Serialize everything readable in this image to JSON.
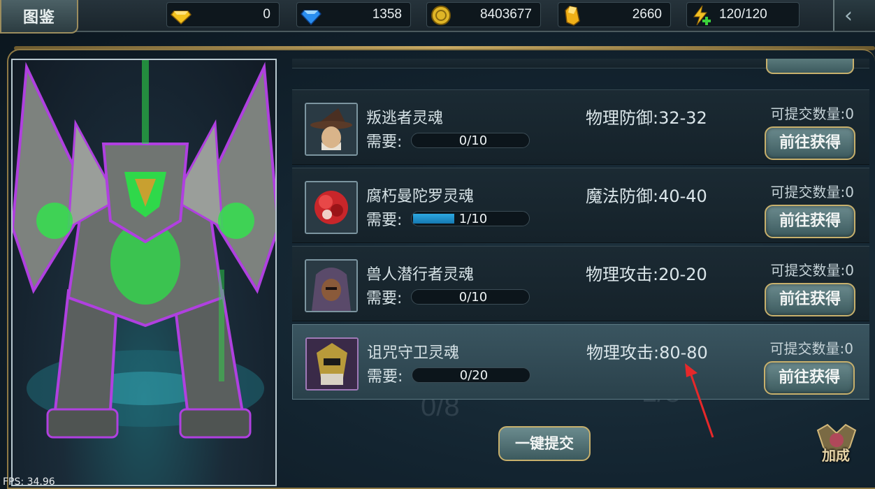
{
  "header": {
    "title": "图鉴",
    "resources": [
      {
        "icon": "yellow-gem-icon",
        "value": "0"
      },
      {
        "icon": "blue-diamond-icon",
        "value": "1358"
      },
      {
        "icon": "gold-coin-icon",
        "value": "8403677"
      },
      {
        "icon": "gold-crystal-icon",
        "value": "2660"
      },
      {
        "icon": "energy-plus-icon",
        "value": "120/120"
      }
    ]
  },
  "portrait": {
    "fps_label": "FPS:",
    "fps": "34.96"
  },
  "background_ghost": {
    "progress_a": "0/8",
    "progress_b": "1/8"
  },
  "items": [
    {
      "name": "叛逃者灵魂",
      "need_label": "需要:",
      "progress_text": "0/10",
      "progress": 0.0,
      "stat": "物理防御:32-32",
      "submit": "可提交数量:0",
      "button": "前往获得",
      "avatar": "wizard-hat-avatar"
    },
    {
      "name": "腐朽曼陀罗灵魂",
      "need_label": "需要:",
      "progress_text": "1/10",
      "progress": 0.1,
      "stat": "魔法防御:40-40",
      "submit": "可提交数量:0",
      "button": "前往获得",
      "avatar": "red-flower-avatar"
    },
    {
      "name": "兽人潜行者灵魂",
      "need_label": "需要:",
      "progress_text": "0/10",
      "progress": 0.0,
      "stat": "物理攻击:20-20",
      "submit": "可提交数量:0",
      "button": "前往获得",
      "avatar": "hooded-orc-avatar"
    },
    {
      "name": "诅咒守卫灵魂",
      "need_label": "需要:",
      "progress_text": "0/20",
      "progress": 0.0,
      "stat": "物理攻击:80-80",
      "submit": "可提交数量:0",
      "button": "前往获得",
      "avatar": "golden-guard-avatar"
    }
  ],
  "actions": {
    "one_key_submit": "一键提交",
    "bonus": "加成"
  }
}
